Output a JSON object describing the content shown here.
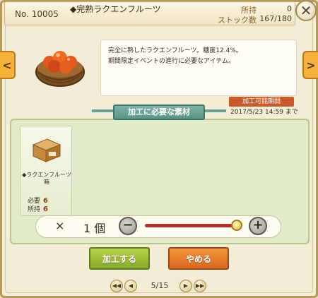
{
  "header": {
    "number": "No. 10005",
    "title": "◆完熟ラクエンフルーツ",
    "owned_label": "所持",
    "owned_value": "0",
    "stock_label": "ストック数",
    "stock_value": "167/180",
    "close_glyph": "✕"
  },
  "item": {
    "description_line1": "完全に熟したラクエンフルーツ。糖度12.4%。",
    "description_line2": "期間限定イベントの進行に必要なアイテム。",
    "icon": "fruit-basket-icon"
  },
  "period": {
    "label": "加工可能期間",
    "date": "2017/5/23 14:59 まで"
  },
  "materials": {
    "section_title": "加工に必要な素材",
    "list": [
      {
        "name": "◆ラクエンフルーツ箱",
        "need_label": "必要",
        "need_value": "6",
        "have_label": "所持",
        "have_value": "6",
        "icon": "cardboard-box-icon"
      }
    ]
  },
  "quantity": {
    "times": "×",
    "value": "1",
    "unit": "個",
    "minus_glyph": "−",
    "plus_glyph": "+",
    "slider_level": 1.0
  },
  "buttons": {
    "process": "加工する",
    "cancel": "やめる"
  },
  "pager": {
    "text": "5/15",
    "first": "◀◀",
    "prev": "◀",
    "next": "▶",
    "last": "▶▶"
  },
  "nav": {
    "left_glyph": "<",
    "right_glyph": ">"
  },
  "colors": {
    "accent_green": "#85a82a",
    "accent_orange": "#d9681f",
    "banner_teal": "#5a9585",
    "period_red": "#c95a2c"
  }
}
